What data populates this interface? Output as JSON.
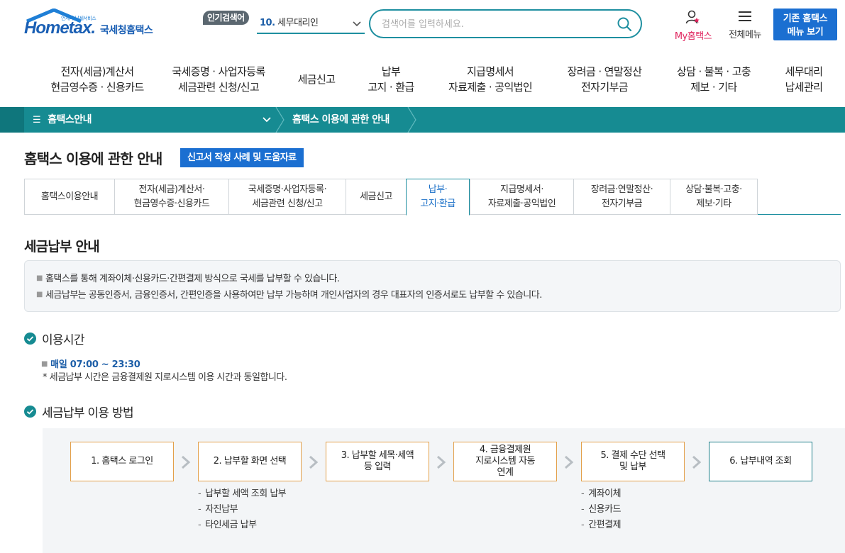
{
  "header": {
    "logo_sub": "언제나 납세서비스",
    "logo_main": "Hometax.",
    "logo_kr": "국세청홈택스",
    "popular_badge": "인기검색어",
    "popular_rank": "10.",
    "popular_term": "세무대리인",
    "search_placeholder": "검색어를 입력하세요.",
    "my_hometax": "My홈택스",
    "all_menu": "전체메뉴",
    "old_menu_line1": "기존 홈택스",
    "old_menu_line2": "메뉴 보기"
  },
  "gnb": [
    {
      "line1": "전자(세금)계산서",
      "line2": "현금영수증 · 신용카드"
    },
    {
      "line1": "국세증명 · 사업자등록",
      "line2": "세금관련 신청/신고"
    },
    {
      "line1": "세금신고",
      "line2": ""
    },
    {
      "line1": "납부",
      "line2": "고지 · 환급"
    },
    {
      "line1": "지급명세서",
      "line2": "자료제출 · 공익법인"
    },
    {
      "line1": "장려금 · 연말정산",
      "line2": "전자기부금"
    },
    {
      "line1": "상담 · 불복 · 고충",
      "line2": "제보 · 기타"
    },
    {
      "line1": "세무대리",
      "line2": "납세관리"
    }
  ],
  "breadcrumb": {
    "menu": "홈택스안내",
    "current": "홈택스 이용에 관한 안내"
  },
  "page": {
    "title": "홈택스 이용에 관한 안내",
    "help_button": "신고서 작성 사례 및 도움자료"
  },
  "tabs": [
    {
      "line1": "홈택스이용안내",
      "line2": ""
    },
    {
      "line1": "전자(세금)계산서·",
      "line2": "현금영수증·신용카드"
    },
    {
      "line1": "국세증명·사업자등록·",
      "line2": "세금관련 신청/신고"
    },
    {
      "line1": "세금신고",
      "line2": ""
    },
    {
      "line1": "납부·",
      "line2": "고지·환급"
    },
    {
      "line1": "지급명세서·",
      "line2": "자료제출·공익법인"
    },
    {
      "line1": "장려금·연말정산·",
      "line2": "전자기부금"
    },
    {
      "line1": "상담·불복·고충·",
      "line2": "제보·기타"
    }
  ],
  "section": {
    "title": "세금납부 안내",
    "info1": "홈택스를 통해 계좌이체·신용카드·간편결제 방식으로 국세를 납부할 수 있습니다.",
    "info2": "세금납부는 공동인증서, 금융인증서, 간편인증을 사용하여만 납부 가능하며 개인사업자의 경우 대표자의 인증서로도 납부할 수 있습니다.",
    "hours_title": "이용시간",
    "hours_value": "매일 07:00 ~ 23:30",
    "hours_note": "* 세금납부 시간은 금융결제원 지로시스템 이용 시간과 동일합니다.",
    "method_title": "세금납부 이용 방법"
  },
  "steps": [
    {
      "line1": "1. 홈택스 로그인",
      "line2": "",
      "line3": ""
    },
    {
      "line1": "2. 납부할 화면 선택",
      "line2": "",
      "line3": ""
    },
    {
      "line1": "3. 납부할 세목·세액",
      "line2": "등 입력",
      "line3": ""
    },
    {
      "line1": "4. 금융결제원",
      "line2": "지로시스템 자동",
      "line3": "연계"
    },
    {
      "line1": "5. 결제 수단 선택",
      "line2": "및 납부",
      "line3": ""
    },
    {
      "line1": "6. 납부내역 조회",
      "line2": "",
      "line3": ""
    }
  ],
  "step2_subs": [
    "납부할 세액 조회 납부",
    "자진납부",
    "타인세금 납부"
  ],
  "step5_subs": [
    "계좌이체",
    "신용카드",
    "간편결제"
  ],
  "colors": {
    "teal": "#168b92",
    "blue": "#1b6fd1",
    "orange_border": "#e3a04a",
    "pink": "#e0245e"
  }
}
